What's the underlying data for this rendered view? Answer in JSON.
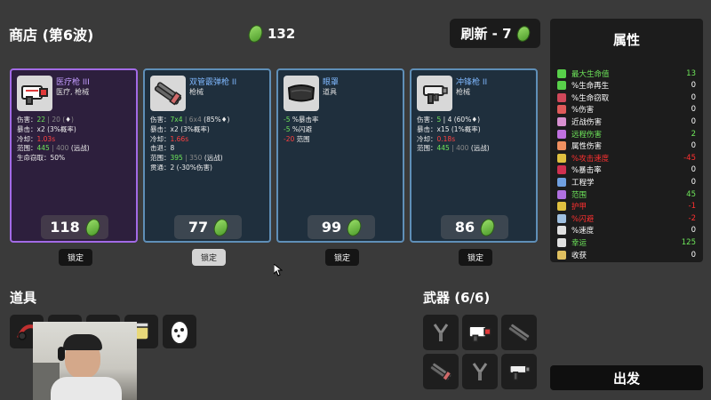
{
  "header": {
    "title": "商店 (第6波)",
    "materials": "132",
    "reroll_label": "刷新 - 7"
  },
  "shop_items": [
    {
      "name": "医疗枪 III",
      "type": "医疗, 枪械",
      "tier_color": "#a26ae6",
      "price": "118",
      "lock_label": "锁定",
      "stats": [
        [
          [
            "伤害：",
            "wht"
          ],
          [
            "22",
            "grn"
          ],
          [
            " | 20 (",
            "gry"
          ],
          [
            "♦",
            "wht"
          ],
          [
            ")",
            "gry"
          ]
        ],
        [
          [
            "暴击：x2 (3%概率)",
            "wht"
          ]
        ],
        [
          [
            "冷却：",
            "wht"
          ],
          [
            "1.03s",
            "red"
          ]
        ],
        [
          [
            "范围：",
            "wht"
          ],
          [
            "445",
            "grn"
          ],
          [
            " | 400",
            "gry"
          ],
          [
            " (远战)",
            "wht"
          ]
        ],
        [
          [
            "生命窃取：50%",
            "wht"
          ]
        ]
      ]
    },
    {
      "name": "双管霰弹枪 II",
      "type": "枪械",
      "tier_color": "#5f8fb8",
      "price": "77",
      "lock_label": "锁定",
      "stats": [
        [
          [
            "伤害：",
            "wht"
          ],
          [
            "7x4",
            "grn"
          ],
          [
            " | 6x4",
            "gry"
          ],
          [
            " (85%",
            "wht"
          ],
          [
            "♦",
            "wht"
          ],
          [
            ")",
            "wht"
          ]
        ],
        [
          [
            "暴击：x2 (3%概率)",
            "wht"
          ]
        ],
        [
          [
            "冷却：",
            "wht"
          ],
          [
            "1.66s",
            "red"
          ]
        ],
        [
          [
            "击退：8",
            "wht"
          ]
        ],
        [
          [
            "范围：",
            "wht"
          ],
          [
            "395",
            "grn"
          ],
          [
            " | 350",
            "gry"
          ],
          [
            " (远战)",
            "wht"
          ]
        ],
        [
          [
            "贯通：2 (-30%伤害)",
            "wht"
          ]
        ]
      ]
    },
    {
      "name": "眼罩",
      "type": "道具",
      "tier_color": "#5f8fb8",
      "price": "99",
      "lock_label": "锁定",
      "stats": [
        [
          [
            "-5",
            "grn"
          ],
          [
            " %暴击率",
            "wht"
          ]
        ],
        [
          [
            "-5",
            "grn"
          ],
          [
            " %闪避",
            "wht"
          ]
        ],
        [
          [
            "-20",
            "red"
          ],
          [
            " 范围",
            "wht"
          ]
        ]
      ]
    },
    {
      "name": "冲锋枪 II",
      "type": "枪械",
      "tier_color": "#5f8fb8",
      "price": "86",
      "lock_label": "锁定",
      "stats": [
        [
          [
            "伤害：",
            "wht"
          ],
          [
            "5",
            "grn"
          ],
          [
            " | 4 (60%",
            "wht"
          ],
          [
            "♦",
            "wht"
          ],
          [
            ")",
            "wht"
          ]
        ],
        [
          [
            "暴击：x15 (1%概率)",
            "wht"
          ]
        ],
        [
          [
            "冷却：",
            "wht"
          ],
          [
            "0.18s",
            "red"
          ]
        ],
        [
          [
            "范围：",
            "wht"
          ],
          [
            "445",
            "grn"
          ],
          [
            " | 400",
            "gry"
          ],
          [
            " (远战)",
            "wht"
          ]
        ]
      ]
    }
  ],
  "items_section": {
    "label": "道具"
  },
  "weapons_section": {
    "label": "武器 (6/6)"
  },
  "stats_panel": {
    "title": "属性",
    "rows": [
      {
        "label": "最大生命值",
        "value": "13",
        "color": "#6ee65a",
        "icon": "heart-icon",
        "icon_color": "#58d04a"
      },
      {
        "label": "%生命再生",
        "value": "0",
        "color": "#ffffff",
        "icon": "regen-icon",
        "icon_color": "#58d04a"
      },
      {
        "label": "%生命窃取",
        "value": "0",
        "color": "#ffffff",
        "icon": "lifesteal-icon",
        "icon_color": "#d0485a"
      },
      {
        "label": "%伤害",
        "value": "0",
        "color": "#ffffff",
        "icon": "damage-icon",
        "icon_color": "#e05a5a"
      },
      {
        "label": "近战伤害",
        "value": "0",
        "color": "#ffffff",
        "icon": "melee-icon",
        "icon_color": "#d890d0"
      },
      {
        "label": "远程伤害",
        "value": "2",
        "color": "#6ee65a",
        "icon": "ranged-icon",
        "icon_color": "#c070e0"
      },
      {
        "label": "属性伤害",
        "value": "0",
        "color": "#ffffff",
        "icon": "elemental-icon",
        "icon_color": "#f09060"
      },
      {
        "label": "%攻击速度",
        "value": "-45",
        "color": "#ff3030",
        "icon": "attack-speed-icon",
        "icon_color": "#e0c040"
      },
      {
        "label": "%暴击率",
        "value": "0",
        "color": "#ffffff",
        "icon": "crit-icon",
        "icon_color": "#d03050"
      },
      {
        "label": "工程学",
        "value": "0",
        "color": "#ffffff",
        "icon": "engineering-icon",
        "icon_color": "#70a0e0"
      },
      {
        "label": "范围",
        "value": "45",
        "color": "#6ee65a",
        "icon": "range-icon",
        "icon_color": "#b070e0"
      },
      {
        "label": "护甲",
        "value": "-1",
        "color": "#ff3030",
        "icon": "armor-icon",
        "icon_color": "#e0c040"
      },
      {
        "label": "%闪避",
        "value": "-2",
        "color": "#ff3030",
        "icon": "dodge-icon",
        "icon_color": "#a0c0e0"
      },
      {
        "label": "%速度",
        "value": "0",
        "color": "#ffffff",
        "icon": "speed-icon",
        "icon_color": "#e0e0e0"
      },
      {
        "label": "幸运",
        "value": "125",
        "color": "#6ee65a",
        "icon": "luck-icon",
        "icon_color": "#e0e0e0"
      },
      {
        "label": "收获",
        "value": "0",
        "color": "#ffffff",
        "icon": "harvest-icon",
        "icon_color": "#e0c060"
      }
    ]
  },
  "go_button": "出发"
}
